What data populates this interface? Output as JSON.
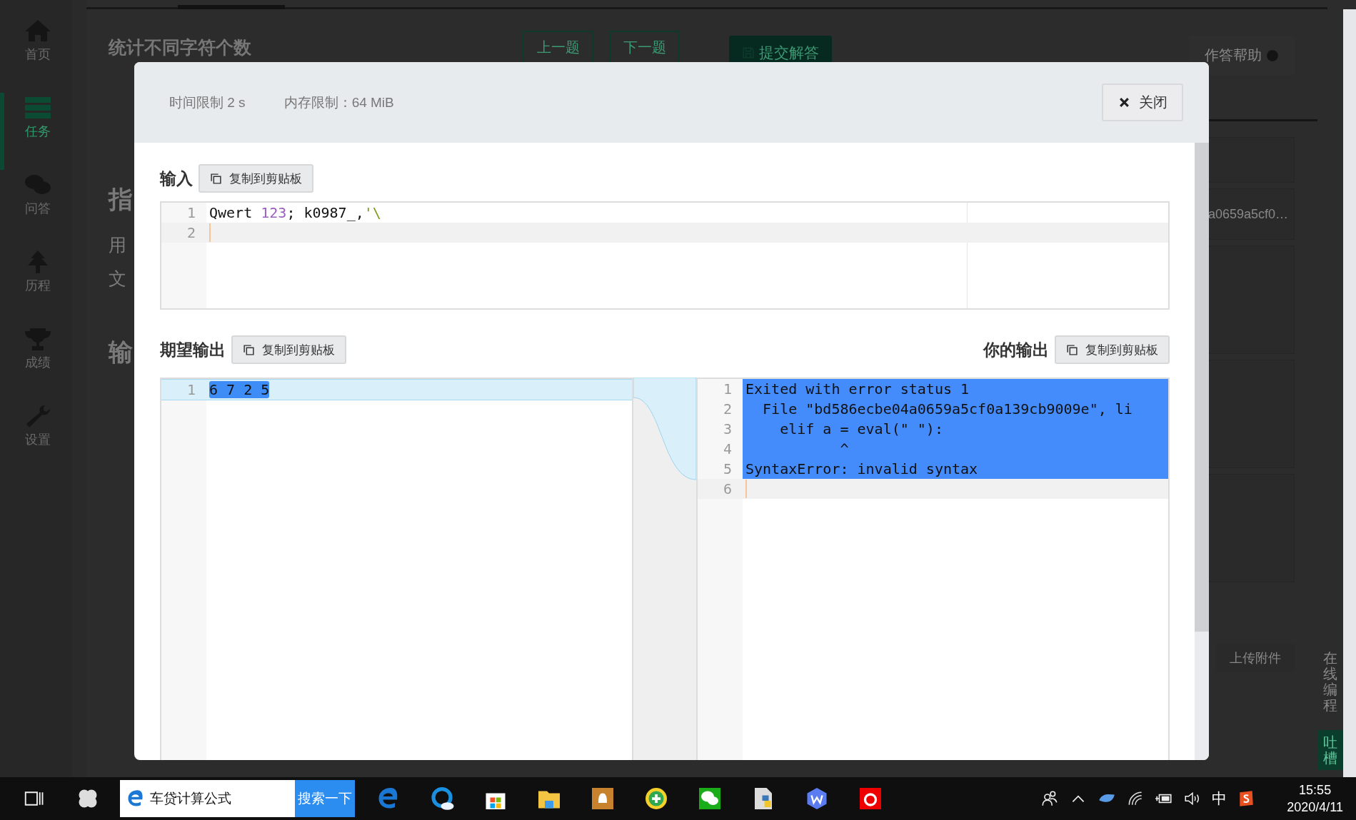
{
  "sidebar": {
    "items": [
      {
        "label": "首页",
        "selected": false
      },
      {
        "label": "任务",
        "selected": true
      },
      {
        "label": "问答",
        "selected": false
      },
      {
        "label": "历程",
        "selected": false
      },
      {
        "label": "成绩",
        "selected": false
      },
      {
        "label": "设置",
        "selected": false
      }
    ]
  },
  "background": {
    "title": "统计不同字符个数",
    "nav_buttons": [
      "上一题",
      "下一题"
    ],
    "submit": "提交解答",
    "help": "作答帮助",
    "fragments": [
      {
        "text": "指",
        "kind": "heading"
      },
      {
        "text": "用",
        "kind": "body"
      },
      {
        "text": "文",
        "kind": "body"
      },
      {
        "text": "输",
        "kind": "heading"
      }
    ],
    "snippet": "a0659a5cf0…",
    "online_coding": "在线编程",
    "upload": "上传附件",
    "feedback": "吐槽"
  },
  "modal": {
    "limits": [
      "时间限制 2 s",
      "内存限制：64 MiB"
    ],
    "close": "关闭",
    "input": {
      "label": "输入",
      "copy": "复制到剪贴板",
      "lines": [
        {
          "number": "1",
          "active": false,
          "tokens": [
            {
              "text": "Qwert ",
              "kind": "plain"
            },
            {
              "text": "123",
              "kind": "number"
            },
            {
              "text": "; k0987_,",
              "kind": "plain"
            },
            {
              "text": "'\\",
              "kind": "string"
            }
          ]
        },
        {
          "number": "2",
          "active": true
        }
      ]
    },
    "expected": {
      "label": "期望输出",
      "copy": "复制到剪贴板",
      "lines": [
        {
          "number": "1",
          "text": "6 7 2 5",
          "changed": true,
          "selected": true,
          "active": false
        }
      ]
    },
    "actual": {
      "label": "你的输出",
      "copy": "复制到剪贴板",
      "lines": [
        {
          "number": "1",
          "text": "Exited with error status 1",
          "selected": true,
          "active": false
        },
        {
          "number": "2",
          "text": "  File \"bd586ecbe04a0659a5cf0a139cb9009e\", li",
          "selected": true,
          "active": false
        },
        {
          "number": "3",
          "text": "    elif a = eval(\" \"):",
          "selected": true,
          "active": false
        },
        {
          "number": "4",
          "text": "           ^",
          "selected": true,
          "active": false
        },
        {
          "number": "5",
          "text": "SyntaxError: invalid syntax",
          "selected": true,
          "active": false
        },
        {
          "number": "6",
          "selected": false,
          "active": true
        }
      ]
    }
  },
  "taskbar": {
    "search_value": "车贷计算公式",
    "search_button": "搜索一下",
    "ime": "中",
    "time": "15:55",
    "date": "2020/4/11"
  }
}
